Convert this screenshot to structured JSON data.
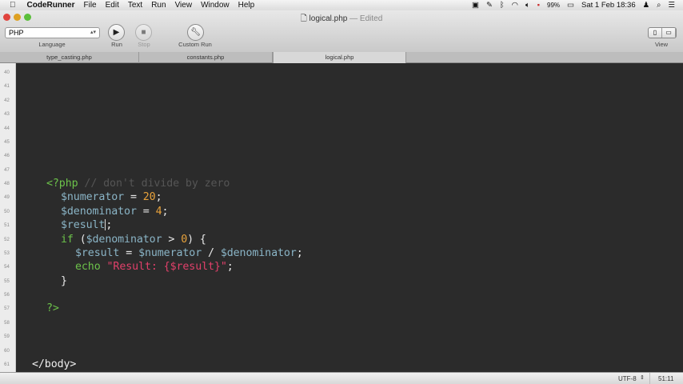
{
  "menubar": {
    "app": "CodeRunner",
    "items": [
      "File",
      "Edit",
      "Text",
      "Run",
      "View",
      "Window",
      "Help"
    ],
    "status": {
      "battery": "99%",
      "date_time": "Sat 1 Feb  18:36"
    }
  },
  "window": {
    "title": "logical.php",
    "edited": "— Edited"
  },
  "toolbar": {
    "language": "PHP",
    "language_label": "Language",
    "run": "Run",
    "stop": "Stop",
    "custom_run": "Custom Run",
    "view": "View"
  },
  "tabs": [
    {
      "label": "type_casting.php",
      "active": false
    },
    {
      "label": "constants.php",
      "active": false
    },
    {
      "label": "logical.php",
      "active": true
    }
  ],
  "line_numbers": [
    "40",
    "41",
    "42",
    "43",
    "44",
    "45",
    "46",
    "47",
    "48",
    "49",
    "50",
    "51",
    "52",
    "53",
    "54",
    "55",
    "56",
    "57",
    "58",
    "59",
    "60",
    "61"
  ],
  "code": [
    {
      "line": 48,
      "indent": 1,
      "tokens": [
        [
          "<?php",
          "tag"
        ],
        [
          " // don't divide by zero",
          "cmt"
        ]
      ]
    },
    {
      "line": 49,
      "indent": 2,
      "tokens": [
        [
          "$numerator",
          "var"
        ],
        [
          " = ",
          "op"
        ],
        [
          "20",
          "num"
        ],
        [
          ";",
          "op"
        ]
      ]
    },
    {
      "line": 50,
      "indent": 2,
      "tokens": [
        [
          "$denominator",
          "var"
        ],
        [
          " = ",
          "op"
        ],
        [
          "4",
          "num"
        ],
        [
          ";",
          "op"
        ]
      ]
    },
    {
      "line": 51,
      "indent": 2,
      "tokens": [
        [
          "$result",
          "var"
        ],
        [
          "|",
          "caret"
        ],
        [
          ";",
          "op"
        ]
      ]
    },
    {
      "line": 52,
      "indent": 2,
      "tokens": [
        [
          "if",
          "kw"
        ],
        [
          " (",
          "op"
        ],
        [
          "$denominator",
          "var"
        ],
        [
          " > ",
          "op"
        ],
        [
          "0",
          "num"
        ],
        [
          ") {",
          "op"
        ]
      ]
    },
    {
      "line": 53,
      "indent": 3,
      "tokens": [
        [
          "$result",
          "var"
        ],
        [
          " = ",
          "op"
        ],
        [
          "$numerator",
          "var"
        ],
        [
          " / ",
          "op"
        ],
        [
          "$denominator",
          "var"
        ],
        [
          ";",
          "op"
        ]
      ]
    },
    {
      "line": 54,
      "indent": 3,
      "tokens": [
        [
          "echo",
          "kw"
        ],
        [
          " ",
          "op"
        ],
        [
          "\"Result: {$result}\"",
          "str"
        ],
        [
          ";",
          "op"
        ]
      ]
    },
    {
      "line": 55,
      "indent": 2,
      "tokens": [
        [
          "}",
          "op"
        ]
      ]
    },
    {
      "line": 57,
      "indent": 1,
      "tokens": [
        [
          "?>",
          "tag"
        ]
      ]
    },
    {
      "line": 61,
      "indent": 0,
      "tokens": [
        [
          "</body>",
          "plain"
        ]
      ]
    }
  ],
  "statusbar": {
    "encoding": "UTF-8",
    "position": "51:11"
  }
}
